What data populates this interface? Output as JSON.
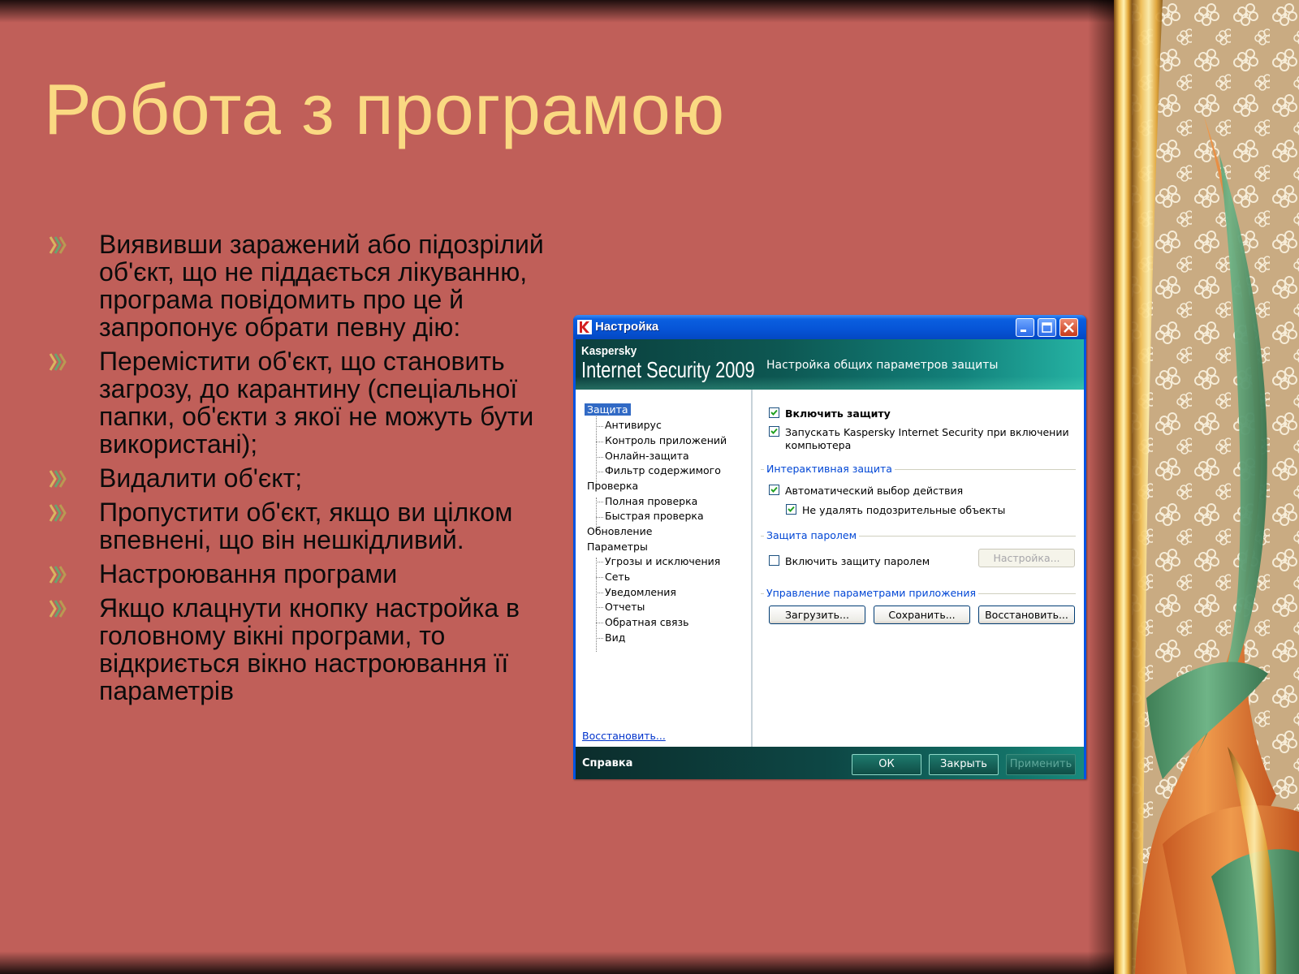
{
  "slide": {
    "title": "Робота з програмою",
    "bullets": [
      "Виявивши заражений або підозрілий об'єкт, що не піддається лікуванню, програма повідомить про це й запропонує обрати певну дію:",
      "Перемістити об'єкт, що становить загрозу, до карантину (спеціальної папки, об'єкти з якої не можуть бути використані);",
      "Видалити об'єкт;",
      "Пропустити об'єкт, якщо ви цілком впевнені, що він нешкідливий.",
      "Настроювання програми",
      "Якщо клацнути кнопку настройка в головному вікні програми, то відкриється вікно настроювання її параметрів"
    ]
  },
  "window": {
    "title": "Настройка",
    "brand_small": "Kaspersky",
    "brand_big": "Internet Security 2009",
    "banner_caption": "Настройка общих параметров защиты",
    "tree": [
      {
        "label": "Защита",
        "level": 0,
        "selected": true
      },
      {
        "label": "Антивирус",
        "level": 1
      },
      {
        "label": "Контроль приложений",
        "level": 1
      },
      {
        "label": "Онлайн-защита",
        "level": 1
      },
      {
        "label": "Фильтр содержимого",
        "level": 1
      },
      {
        "label": "Проверка",
        "level": 0
      },
      {
        "label": "Полная проверка",
        "level": 1
      },
      {
        "label": "Быстрая проверка",
        "level": 1
      },
      {
        "label": "Обновление",
        "level": 0
      },
      {
        "label": "Параметры",
        "level": 0
      },
      {
        "label": "Угрозы и исключения",
        "level": 1
      },
      {
        "label": "Сеть",
        "level": 1
      },
      {
        "label": "Уведомления",
        "level": 1
      },
      {
        "label": "Отчеты",
        "level": 1
      },
      {
        "label": "Обратная связь",
        "level": 1
      },
      {
        "label": "Вид",
        "level": 1
      }
    ],
    "restore_link": "Восстановить...",
    "options": {
      "enable_protection": {
        "label": "Включить защиту",
        "checked": true
      },
      "autostart": {
        "label": "Запускать Kaspersky Internet Security при включении",
        "label_line2": "компьютера",
        "checked": true
      },
      "interactive_group": "Интерактивная защита",
      "auto_action": {
        "label": "Автоматический выбор действия",
        "checked": true
      },
      "keep_suspicious": {
        "label": "Не удалять подозрительные объекты",
        "checked": true
      },
      "password_group": "Защита паролем",
      "password_protection": {
        "label": "Включить защиту паролем",
        "checked": false
      },
      "password_settings_button": "Настройка...",
      "manage_group": "Управление параметрами приложения",
      "load_button": "Загрузить...",
      "save_button": "Сохранить...",
      "restore_button": "Восстановить..."
    },
    "footer": {
      "help": "Справка",
      "ok": "ОК",
      "close": "Закрыть",
      "apply": "Применить"
    }
  },
  "colors": {
    "slide_background": "#c05f59",
    "title_color": "#fad982",
    "body_text": "#0b0b0b",
    "selection": "#316ac5",
    "kaspersky_teal": "#0d5752"
  }
}
